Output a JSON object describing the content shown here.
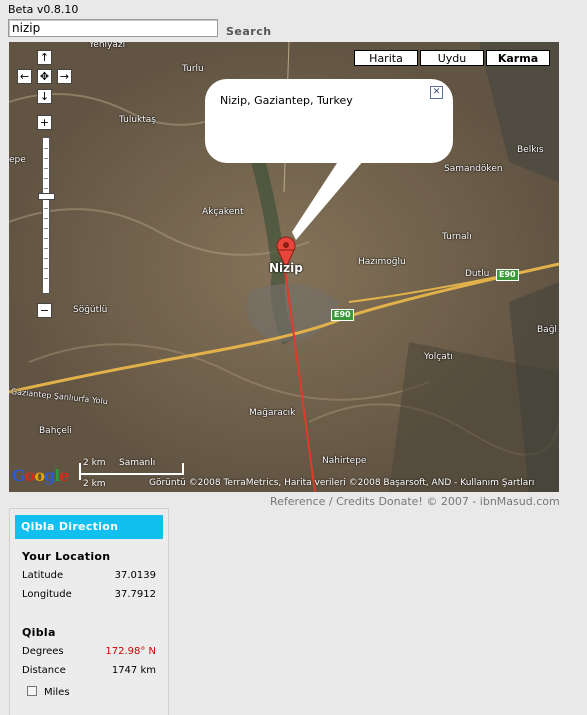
{
  "app": {
    "version": "Beta v0.8.10"
  },
  "search": {
    "value": "nizip",
    "button_label": "Search"
  },
  "map": {
    "types": [
      "Harita",
      "Uydu",
      "Karma"
    ],
    "active_type": "Karma",
    "controls": {
      "up": "↑",
      "left": "←",
      "center": "✥",
      "right": "→",
      "down": "↓",
      "zoom_in": "+",
      "zoom_out": "−"
    },
    "info_window": {
      "text": "Nizip, Gaziantep, Turkey",
      "close": "✕"
    },
    "labels": {
      "yeniyazi": "Yeniyazı",
      "turlu": "Turlu",
      "tuluktas": "Tuluktaş",
      "belkis": "Belkıs",
      "samandoken": "Samandöken",
      "akcakent": "Akçakent",
      "turnali": "Turnalı",
      "nizip": "Nizip",
      "hazimoglu": "Hazımoğlu",
      "dutlu": "Dutlu",
      "sogutlu": "Söğütlü",
      "bagl": "Bağl",
      "yolcati": "Yolçatı",
      "road_name": "Gaziantep Şanlıurfa Yolu",
      "bahceli": "Bahçeli",
      "magaracik": "Mağaracık",
      "nahirtepe": "Nahirtepe",
      "edge_left": "epe"
    },
    "shields": {
      "e90_a": "E90",
      "e90_b": "E90"
    },
    "scale": {
      "top": "2 km",
      "bottom": "2 km",
      "city": "Samanlı"
    },
    "copyright": "Görüntü ©2008 TerraMetrics, Harita verileri ©2008 Başarsoft, AND - Kullanım Şartları",
    "logo": "Google"
  },
  "footer": {
    "reference": "Reference",
    "separator": "/",
    "credits": "Credits",
    "donate": "Donate!",
    "copyright": "© 2007 - ibnMasud.com"
  },
  "qibla": {
    "title": "Qibla Direction",
    "your_location": "Your Location",
    "latitude_label": "Latitude",
    "latitude": "37.0139",
    "longitude_label": "Longitude",
    "longitude": "37.7912",
    "qibla_heading": "Qibla",
    "degrees_label": "Degrees",
    "degrees": "172.98° N",
    "distance_label": "Distance",
    "distance": "1747 km",
    "miles_label": "Miles",
    "miles_checked": false
  }
}
